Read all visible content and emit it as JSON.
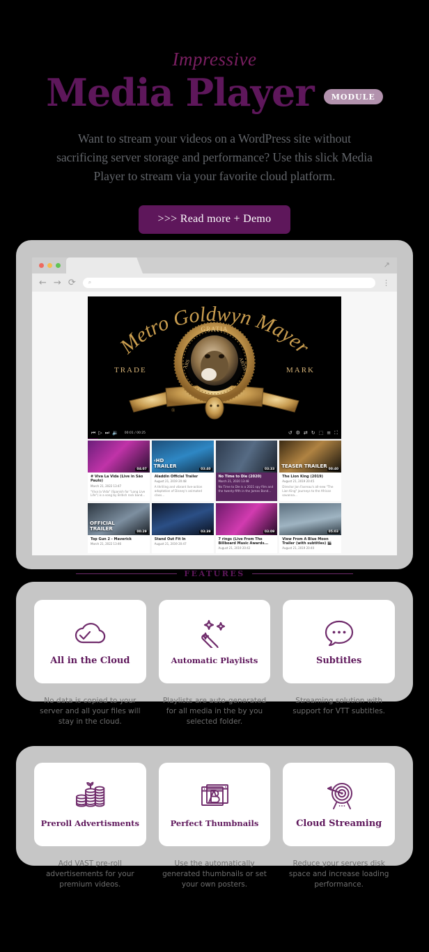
{
  "hero": {
    "eyebrow": "Impressive",
    "title": "Media Player",
    "badge": "MODULE",
    "subtitle": "Want to stream your videos on a WordPress site without sacrificing server storage and performance? Use this slick Media Player to stream via your favorite cloud platform.",
    "cta": ">>> Read more + Demo"
  },
  "colors": {
    "accent": "#5e175b",
    "accent_icon": "#6f2b6b",
    "badge_bg": "#b292ad",
    "page_bg": "#000000",
    "panel_bg": "#c6c6c6",
    "body_text": "#63666b"
  },
  "browser": {
    "traffic_lights": [
      "red-dot",
      "yellow-dot",
      "green-dot"
    ],
    "expand_icon": "expand-icon",
    "back_icon": "←",
    "forward_icon": "→",
    "reload_icon": "⟳",
    "address_icon": "⌕",
    "address_value": "",
    "menu_icon": "⋮"
  },
  "player": {
    "poster_text_top": "Metro Goldwyn Mayer",
    "trade": "TRADE",
    "mark": "MARK",
    "crest_top": "GRATIA",
    "crest_left": "ARS",
    "crest_right": "ARTIS",
    "time": "00:01 / 00:25",
    "controls_left": [
      {
        "name": "previous-track-icon",
        "glyph": "⏮"
      },
      {
        "name": "play-icon",
        "glyph": "▷"
      },
      {
        "name": "next-track-icon",
        "glyph": "⏭"
      },
      {
        "name": "volume-icon",
        "glyph": "🔉"
      }
    ],
    "controls_right": [
      {
        "name": "replay-icon",
        "glyph": "↺"
      },
      {
        "name": "speed-icon",
        "glyph": "⚙"
      },
      {
        "name": "shuffle-icon",
        "glyph": "⇄"
      },
      {
        "name": "repeat-icon",
        "glyph": "↻"
      },
      {
        "name": "picture-in-picture-icon",
        "glyph": "⬚"
      },
      {
        "name": "playlist-icon",
        "glyph": "≡"
      },
      {
        "name": "fullscreen-icon",
        "glyph": "⛶"
      }
    ],
    "progress_percent": 4
  },
  "playlist": [
    {
      "title": "# Viva La Vida (Live in São Paulo)",
      "date": "March 21, 2022 13:47",
      "desc": "\"Viva la Vida\" (Spanish for \"Long Live Life\") is a song by British rock band...",
      "duration": "04:07",
      "overlay": "",
      "active": false
    },
    {
      "title": "Aladdin Official Trailer",
      "date": "August 21, 2019 20:48",
      "desc": "A thrilling and vibrant live-action adaptation of Disney's animated class...",
      "duration": "03:40",
      "overlay": "‹HD\nTRAILER",
      "active": false
    },
    {
      "title": "No Time to Die (2020)",
      "date": "March 21, 2020 13:48",
      "desc": "No Time to Die is a 2021 spy film and the twenty-fifth in the James Bond...",
      "duration": "03:33",
      "overlay": "",
      "active": true
    },
    {
      "title": "The Lion King (2019)",
      "date": "August 21, 2019 20:45",
      "desc": "Director Jon Favreau's all-new \"The Lion King\" journeys to the African savanna...",
      "duration": "00:40",
      "overlay": "TEASER TRAILER",
      "active": false
    },
    {
      "title": "Top Gun 2 - Maverick",
      "date": "March 21, 2022 13:46",
      "desc": "",
      "duration": "00:29",
      "overlay": "OFFICIAL\nTRAILER",
      "active": false
    },
    {
      "title": "Stand Out Fit In",
      "date": "August 21, 2019 20:47",
      "desc": "",
      "duration": "03:39",
      "overlay": "",
      "active": false
    },
    {
      "title": "7 rings (Live From The Billboard Music Awards...",
      "date": "August 21, 2019 20:42",
      "desc": "",
      "duration": "03:09",
      "overlay": "",
      "active": false
    },
    {
      "title": "View From A Blue Moon Trailer (with subtitles) 🎬",
      "date": "August 21, 2019 20:40",
      "desc": "",
      "duration": "05:03",
      "overlay": "",
      "active": false
    }
  ],
  "features": {
    "heading": "FEATURES",
    "row1": [
      {
        "icon": "cloud-check-icon",
        "label": "All in the Cloud",
        "desc": "No data is copied to your server and all your files will stay in the cloud."
      },
      {
        "icon": "magic-wand-icon",
        "label": "Automatic Playlists",
        "desc": "Playlists are auto-generated for all media in the by you selected folder."
      },
      {
        "icon": "speech-bubble-icon",
        "label": "Subtitles",
        "desc": "Streaming solution with support for VTT subtitles."
      }
    ],
    "row2": [
      {
        "icon": "coins-stack-icon",
        "label": "Preroll Advertisments",
        "desc": "Add VAST pre-roll advertisements for your premium videos."
      },
      {
        "icon": "image-thumbnail-icon",
        "label": "Perfect Thumbnails",
        "desc": "Use the automatically generated thumbnails or set your own posters."
      },
      {
        "icon": "target-arrow-icon",
        "label": "Cloud Streaming",
        "desc": "Reduce your servers disk space and increase loading performance."
      }
    ]
  }
}
